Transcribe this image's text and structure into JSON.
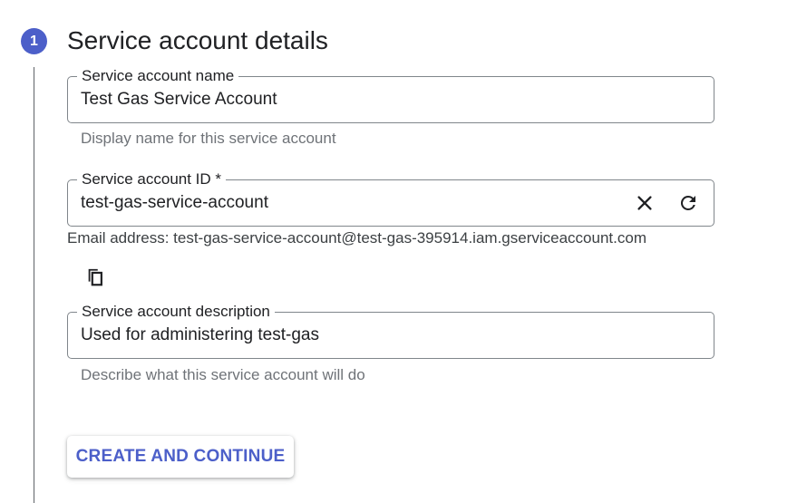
{
  "step": {
    "number": "1",
    "title": "Service account details"
  },
  "fields": {
    "name": {
      "label": "Service account name",
      "value": "Test Gas Service Account",
      "hint": "Display name for this service account"
    },
    "id": {
      "label": "Service account ID *",
      "value": "test-gas-service-account",
      "email_text": "Email address: test-gas-service-account@test-gas-395914.iam.gserviceaccount.com"
    },
    "description": {
      "label": "Service account description",
      "value": "Used for administering test-gas",
      "hint": "Describe what this service account will do"
    }
  },
  "icons": {
    "clear": "close-icon",
    "regenerate": "refresh-icon",
    "copy": "copy-icon"
  },
  "actions": {
    "create_continue": "CREATE AND CONTINUE"
  },
  "colors": {
    "accent": "#4c5fc9",
    "border": "#80868b",
    "hint_text": "#6f7378"
  }
}
